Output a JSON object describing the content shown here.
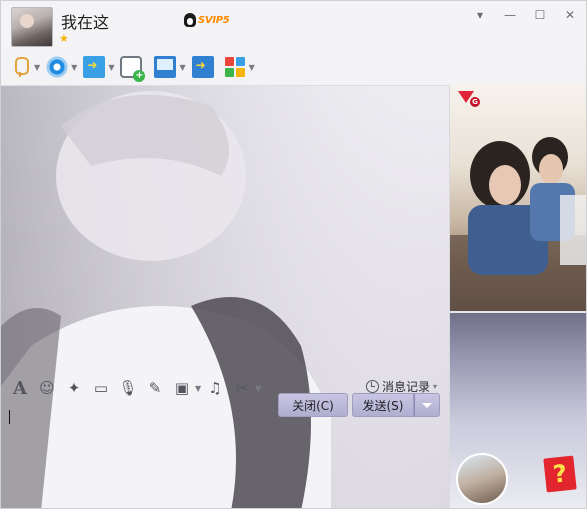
{
  "titlebar": {
    "contact_name": "我在这",
    "vip_label": "SVIP5",
    "controls": {
      "menu": "▾",
      "minimize": "—",
      "maximize": "☐",
      "close": "✕"
    }
  },
  "toolbar": {
    "items": [
      {
        "name": "voice-call",
        "icon": "microphone-icon",
        "has_dropdown": true
      },
      {
        "name": "video-call",
        "icon": "camera-icon",
        "has_dropdown": true
      },
      {
        "name": "send-file",
        "icon": "folder-send-icon",
        "has_dropdown": true
      },
      {
        "name": "create-discussion",
        "icon": "chat-add-icon",
        "has_dropdown": false
      },
      {
        "name": "remote-desktop",
        "icon": "monitor-icon",
        "has_dropdown": true
      },
      {
        "name": "share-screen",
        "icon": "share-screen-icon",
        "has_dropdown": false
      },
      {
        "name": "apps",
        "icon": "apps-grid-icon",
        "has_dropdown": true
      }
    ]
  },
  "format_bar": {
    "font_icon": "A",
    "history_label": "消息记录",
    "history_caret": "▾"
  },
  "buttons": {
    "close": "关闭(C)",
    "send": "发送(S)"
  },
  "right_panel": {
    "gem_badge": "G",
    "help_label": "?"
  },
  "colors": {
    "button_bg": "#b9b5d6",
    "vip": "#ff8a00",
    "help": "#e3262e",
    "gem": "#e0243a"
  }
}
